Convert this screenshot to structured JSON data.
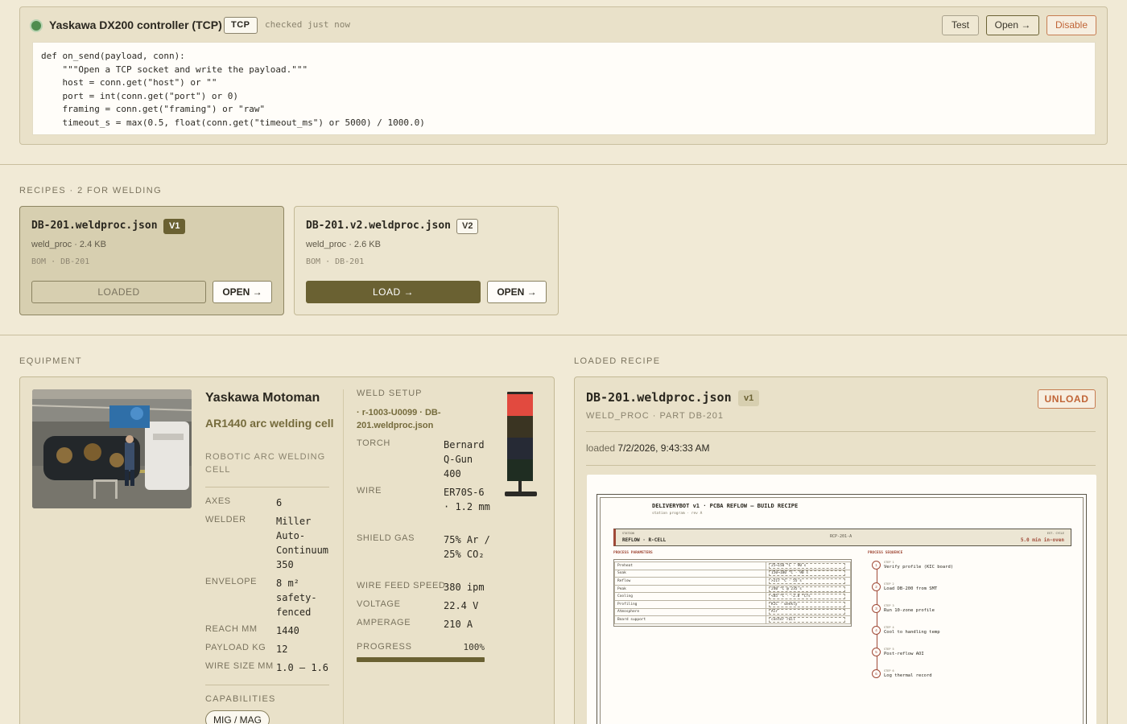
{
  "connector": {
    "status_color": "#4e8c4e",
    "title": "Yaskawa DX200 controller (TCP)",
    "protocol": "TCP",
    "checked": "checked just now",
    "test_label": "Test",
    "open_label": "Open →",
    "disable_label": "Disable",
    "code": "def on_send(payload, conn):\n    \"\"\"Open a TCP socket and write the payload.\"\"\"\n    host = conn.get(\"host\") or \"\"\n    port = int(conn.get(\"port\") or 0)\n    framing = conn.get(\"framing\") or \"raw\"\n    timeout_s = max(0.5, float(conn.get(\"timeout_ms\") or 5000) / 1000.0)"
  },
  "recipes": {
    "heading": "RECIPES · 2 FOR WELDING",
    "items": [
      {
        "name": "DB-201.weldproc.json",
        "version": "V1",
        "meta": "weld_proc · 2.4 KB",
        "bom": "BOM · DB-201",
        "action": "LOADED",
        "open": "OPEN →"
      },
      {
        "name": "DB-201.v2.weldproc.json",
        "version": "V2",
        "meta": "weld_proc · 2.6 KB",
        "bom": "BOM · DB-201",
        "action": "LOAD →",
        "open": "OPEN →"
      }
    ]
  },
  "equipment": {
    "heading": "EQUIPMENT",
    "name": "Yaskawa Motoman",
    "model": "AR1440 arc welding cell",
    "type": "ROBOTIC ARC WELDING CELL",
    "specs": [
      {
        "key": "AXES",
        "value": "6"
      },
      {
        "key": "WELDER",
        "value": "Miller Auto-Continuum 350"
      },
      {
        "key": "ENVELOPE",
        "value": "8 m² safety-fenced"
      },
      {
        "key": "REACH MM",
        "value": "1440"
      },
      {
        "key": "PAYLOAD KG",
        "value": "12"
      },
      {
        "key": "WIRE SIZE MM",
        "value": "1.0 – 1.6"
      }
    ],
    "capabilities_label": "CAPABILITIES",
    "capabilities": [
      "MIG / MAG"
    ],
    "weld_setup": {
      "label": "WELD SETUP",
      "path": "· r-1003-U0099 · DB-201.weldproc.json",
      "params": [
        {
          "key": "TORCH",
          "value": "Bernard Q-Gun 400"
        },
        {
          "key": "WIRE",
          "value": "ER70S-6 · 1.2 mm"
        },
        {
          "key": "SHIELD GAS",
          "value": "75% Ar / 25% CO₂"
        },
        {
          "key": "WIRE FEED SPEED",
          "value": "380 ipm"
        },
        {
          "key": "VOLTAGE",
          "value": "22.4 V"
        },
        {
          "key": "AMPERAGE",
          "value": "210 A"
        }
      ],
      "progress_label": "PROGRESS",
      "progress_text": "100%",
      "progress": 1.0
    },
    "stack_light": {
      "active": "red",
      "red": "#e24a3f",
      "amber": "#3a3422",
      "blue": "#262a35",
      "green": "#1f2d22"
    }
  },
  "loaded": {
    "heading": "LOADED RECIPE",
    "name": "DB-201.weldproc.json",
    "version": "v1",
    "subtitle": "WELD_PROC · PART DB-201",
    "unload_label": "UNLOAD",
    "loaded_prefix": "loaded",
    "loaded_time": "7/2/2026, 9:43:33 AM",
    "doc": {
      "title": "DELIVERYBOT v1 · PCBA REFLOW — BUILD RECIPE",
      "subtitle": "station program · rev A",
      "station_label": "STATION",
      "station": "REFLOW · R-CELL",
      "code": "RCP-201-A",
      "cycle_label": "EST. CYCLE",
      "cycle": "5.0 min in-oven",
      "params_heading": "PROCESS PARAMETERS",
      "params": [
        {
          "k": "Preheat",
          "v": "25→150 °C · 90 s"
        },
        {
          "k": "Soak",
          "v": "150→180 °C · 90 s"
        },
        {
          "k": "Reflow",
          "v": ">217 °C · 55 s"
        },
        {
          "k": "Peak",
          "v": "240 °C @ 235 s"
        },
        {
          "k": "Cooling",
          "v": "<85 °C · -2.8 °C/s"
        },
        {
          "k": "Profiling",
          "v": "KIC · weekly"
        },
        {
          "k": "Atmosphere",
          "v": "Air"
        },
        {
          "k": "Board support",
          "v": "center rail"
        }
      ],
      "sequence_heading": "PROCESS SEQUENCE",
      "steps": [
        {
          "n": "1",
          "s": "STEP 1",
          "t": "Verify profile (KIC board)"
        },
        {
          "n": "2",
          "s": "STEP 2",
          "t": "Load DB-200 from SMT"
        },
        {
          "n": "3",
          "s": "STEP 3",
          "t": "Run 10-zone profile"
        },
        {
          "n": "4",
          "s": "STEP 4",
          "t": "Cool to handling temp"
        },
        {
          "n": "5",
          "s": "STEP 5",
          "t": "Post-reflow AOI"
        },
        {
          "n": "6",
          "s": "STEP 6",
          "t": "Log thermal record"
        }
      ]
    }
  }
}
